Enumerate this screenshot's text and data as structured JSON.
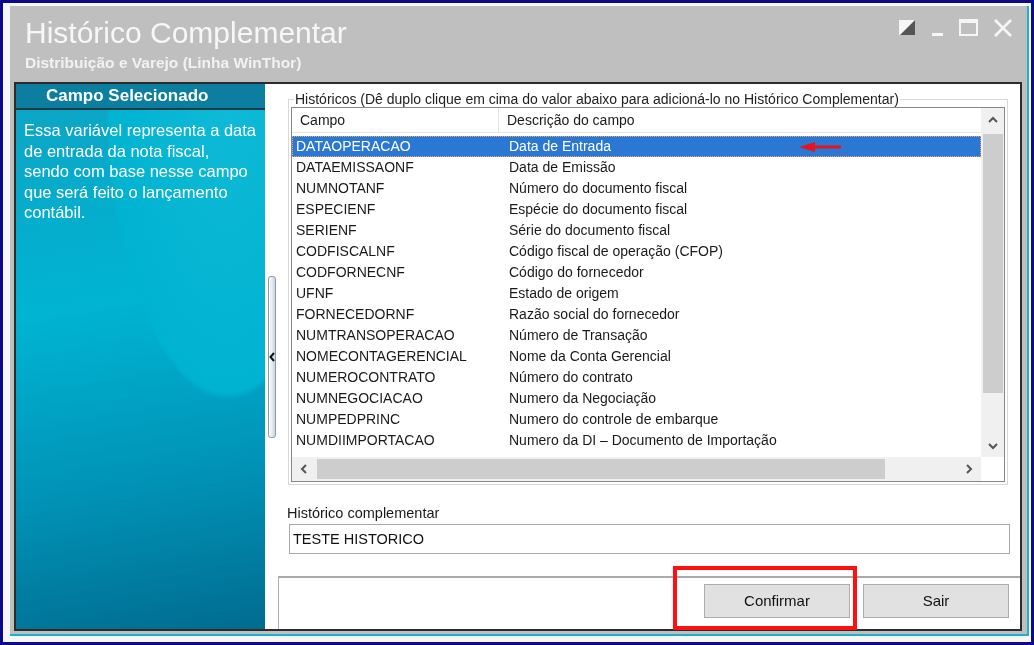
{
  "window": {
    "title": "Histórico Complementar",
    "subtitle": "Distribuição e Varejo (Linha WinThor)"
  },
  "side_panel": {
    "heading": "Campo Selecionado",
    "description": "Essa variável representa a data de entrada da nota fiscal, sendo com base nesse campo que será feito o lançamento contábil."
  },
  "history_list": {
    "legend": "Históricos (Dê duplo clique em cima do valor abaixo para adicioná-lo no Histórico Complementar)",
    "columns": [
      "Campo",
      "Descrição do campo"
    ],
    "rows": [
      {
        "field": "DATAOPERACAO",
        "description": "Data de Entrada",
        "selected": true,
        "marked": true
      },
      {
        "field": "DATAEMISSAONF",
        "description": "Data de Emissão",
        "selected": false,
        "marked": false
      },
      {
        "field": "NUMNOTANF",
        "description": "Número do documento fiscal",
        "selected": false,
        "marked": false
      },
      {
        "field": "ESPECIENF",
        "description": "Espécie do documento fiscal",
        "selected": false,
        "marked": false
      },
      {
        "field": "SERIENF",
        "description": "Série do documento fiscal",
        "selected": false,
        "marked": false
      },
      {
        "field": "CODFISCALNF",
        "description": "Código fiscal de operação (CFOP)",
        "selected": false,
        "marked": false
      },
      {
        "field": "CODFORNECNF",
        "description": "Código do fornecedor",
        "selected": false,
        "marked": false
      },
      {
        "field": "UFNF",
        "description": "Estado de origem",
        "selected": false,
        "marked": false
      },
      {
        "field": "FORNECEDORNF",
        "description": "Razão social do fornecedor",
        "selected": false,
        "marked": false
      },
      {
        "field": "NUMTRANSOPERACAO",
        "description": "Número de Transação",
        "selected": false,
        "marked": false
      },
      {
        "field": "NOMECONTAGERENCIAL",
        "description": "Nome da Conta Gerencial",
        "selected": false,
        "marked": false
      },
      {
        "field": "NUMEROCONTRATO",
        "description": "Número do contrato",
        "selected": false,
        "marked": false
      },
      {
        "field": "NUMNEGOCIACAO",
        "description": "Numero da Negociação",
        "selected": false,
        "marked": false
      },
      {
        "field": "NUMPEDPRINC",
        "description": "Numero do controle de embarque",
        "selected": false,
        "marked": false
      },
      {
        "field": "NUMDIIMPORTACAO",
        "description": "Numero da DI – Documento de Importação",
        "selected": false,
        "marked": false
      }
    ]
  },
  "history_field": {
    "label": "Histórico complementar",
    "value": "TESTE HISTORICO"
  },
  "buttons": [
    {
      "label": "Confirmar",
      "highlighted": true
    },
    {
      "label": "Sair",
      "highlighted": false
    }
  ]
}
